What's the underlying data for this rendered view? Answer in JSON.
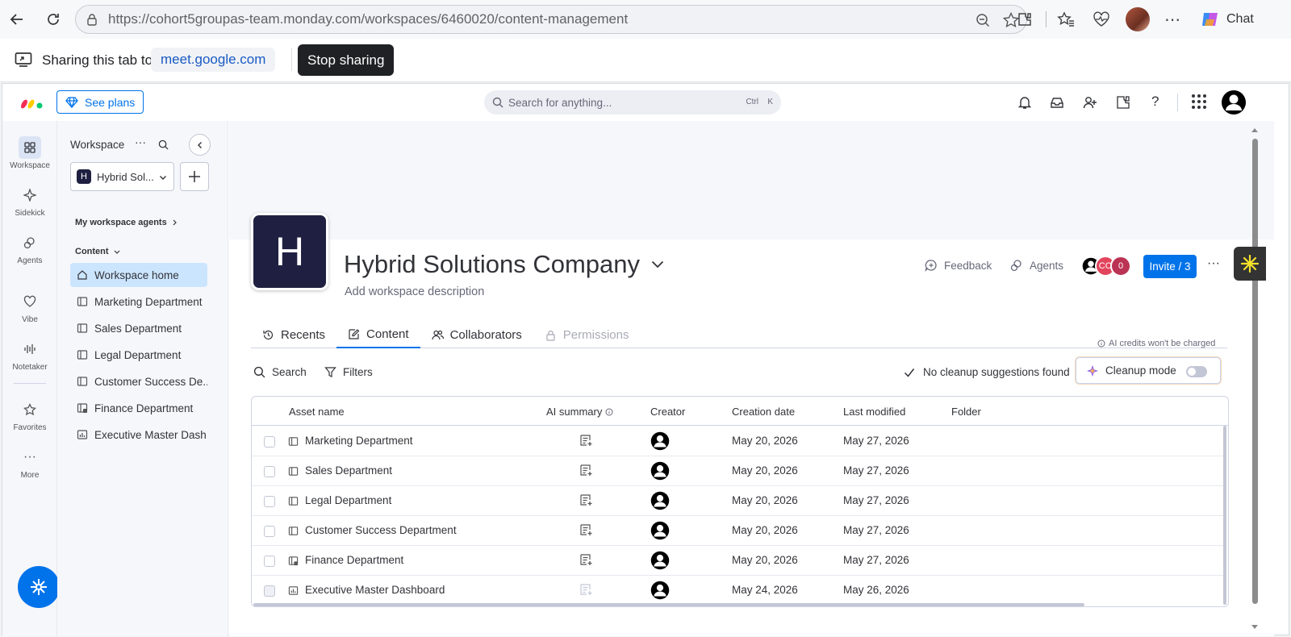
{
  "browser": {
    "url_domain": "https://cohort5groupas-team.monday.com",
    "url_path": "/workspaces/6460020/content-management",
    "chat_label": "Chat"
  },
  "share_bar": {
    "sharing_text": "Sharing this tab to",
    "target": "meet.google.com",
    "stop_label": "Stop sharing"
  },
  "topnav": {
    "see_plans": "See plans",
    "search_placeholder": "Search for anything...",
    "shortcut_ctrl": "Ctrl",
    "shortcut_key": "K"
  },
  "rail": {
    "items": [
      {
        "label": "Workspace",
        "icon": "grid-icon"
      },
      {
        "label": "Sidekick",
        "icon": "sparkle-icon"
      },
      {
        "label": "Agents",
        "icon": "agents-icon"
      },
      {
        "label": "Vibe",
        "icon": "heart-icon"
      },
      {
        "label": "Notetaker",
        "icon": "waveform-icon"
      },
      {
        "label": "Favorites",
        "icon": "star-icon"
      },
      {
        "label": "More",
        "icon": "more-icon"
      }
    ]
  },
  "sidebar": {
    "title": "Workspace",
    "workspace_letter": "H",
    "workspace_name": "Hybrid Sol...",
    "agents_label": "My workspace agents",
    "content_label": "Content",
    "items": [
      {
        "label": "Workspace home",
        "icon": "home-icon"
      },
      {
        "label": "Marketing Department",
        "icon": "board-icon"
      },
      {
        "label": "Sales Department",
        "icon": "board-icon"
      },
      {
        "label": "Legal Department",
        "icon": "board-icon"
      },
      {
        "label": "Customer Success De...",
        "icon": "board-icon"
      },
      {
        "label": "Finance Department",
        "icon": "private-board-icon"
      },
      {
        "label": "Executive Master Dash...",
        "icon": "dashboard-icon"
      }
    ]
  },
  "workspace": {
    "letter": "H",
    "name": "Hybrid Solutions Company",
    "description_placeholder": "Add workspace description",
    "feedback": "Feedback",
    "agents": "Agents",
    "avatar_initials": "CO",
    "avatar_extra": "0",
    "invite_label": "Invite / 3"
  },
  "tabs": [
    {
      "label": "Recents",
      "icon": "history-icon"
    },
    {
      "label": "Content",
      "icon": "edit-icon"
    },
    {
      "label": "Collaborators",
      "icon": "people-icon"
    },
    {
      "label": "Permissions",
      "icon": "lock-icon"
    }
  ],
  "toolbar": {
    "ai_credits": "AI credits won't be charged",
    "search": "Search",
    "filters": "Filters",
    "cleanup_status": "No cleanup suggestions found",
    "cleanup_mode": "Cleanup mode"
  },
  "table": {
    "columns": [
      "Asset name",
      "AI summary",
      "Creator",
      "Creation date",
      "Last modified",
      "Folder"
    ],
    "rows": [
      {
        "name": "Marketing Department",
        "icon": "board-icon",
        "created": "May 20, 2026",
        "modified": "May 27, 2026",
        "folder": ""
      },
      {
        "name": "Sales Department",
        "icon": "board-icon",
        "created": "May 20, 2026",
        "modified": "May 27, 2026",
        "folder": ""
      },
      {
        "name": "Legal Department",
        "icon": "board-icon",
        "created": "May 20, 2026",
        "modified": "May 27, 2026",
        "folder": ""
      },
      {
        "name": "Customer Success Department",
        "icon": "board-icon",
        "created": "May 20, 2026",
        "modified": "May 27, 2026",
        "folder": ""
      },
      {
        "name": "Finance Department",
        "icon": "private-board-icon",
        "created": "May 20, 2026",
        "modified": "May 27, 2026",
        "folder": ""
      },
      {
        "name": "Executive Master Dashboard",
        "icon": "dashboard-icon",
        "created": "May 24, 2026",
        "modified": "May 26, 2026",
        "folder": ""
      }
    ]
  },
  "colors": {
    "primary": "#0073ea",
    "sidebar_selected": "#cce5ff",
    "logo_bg": "#1f2041"
  }
}
